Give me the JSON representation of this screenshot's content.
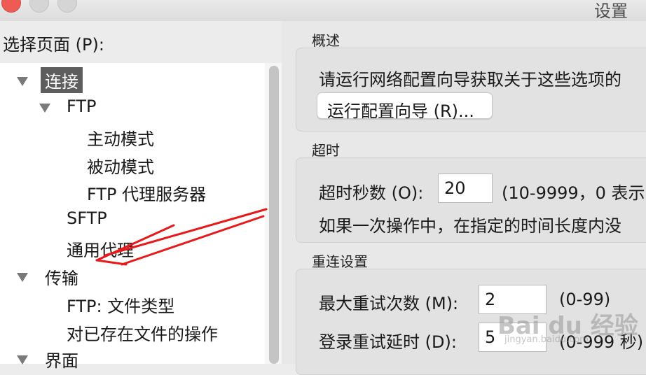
{
  "window": {
    "title": "设置"
  },
  "left": {
    "label": "选择页面 (P):",
    "tree": {
      "connect": "连接",
      "ftp": "FTP",
      "active_mode": "主动模式",
      "passive_mode": "被动模式",
      "ftp_proxy": "FTP 代理服务器",
      "sftp": "SFTP",
      "generic_proxy": "通用代理",
      "transfer": "传输",
      "ftp_file_types": "FTP: 文件类型",
      "existing_file_action": "对已存在文件的操作",
      "interface": "界面"
    }
  },
  "overview": {
    "title": "概述",
    "description": "请运行网络配置向导获取关于这些选项的",
    "wizard_button": "运行配置向导 (R)..."
  },
  "timeout": {
    "title": "超时",
    "seconds_label": "超时秒数 (O):",
    "seconds_value": "20",
    "range_note": "(10-9999，0 表示",
    "description": "如果一次操作中，在指定的时间长度内没"
  },
  "reconnect": {
    "title": "重连设置",
    "max_retries_label": "最大重试次数 (M):",
    "max_retries_value": "2",
    "max_retries_range": "(0-99)",
    "login_delay_label": "登录重试延时 (D):",
    "login_delay_value": "5",
    "login_delay_range": "(0-999 秒)"
  },
  "watermark": {
    "text": "Bai du 经验",
    "url": "jingyan.baidu.com"
  },
  "colors": {
    "selection": "#5e5e5e",
    "close": "#ee5b55",
    "arrow": "#e8191b"
  }
}
